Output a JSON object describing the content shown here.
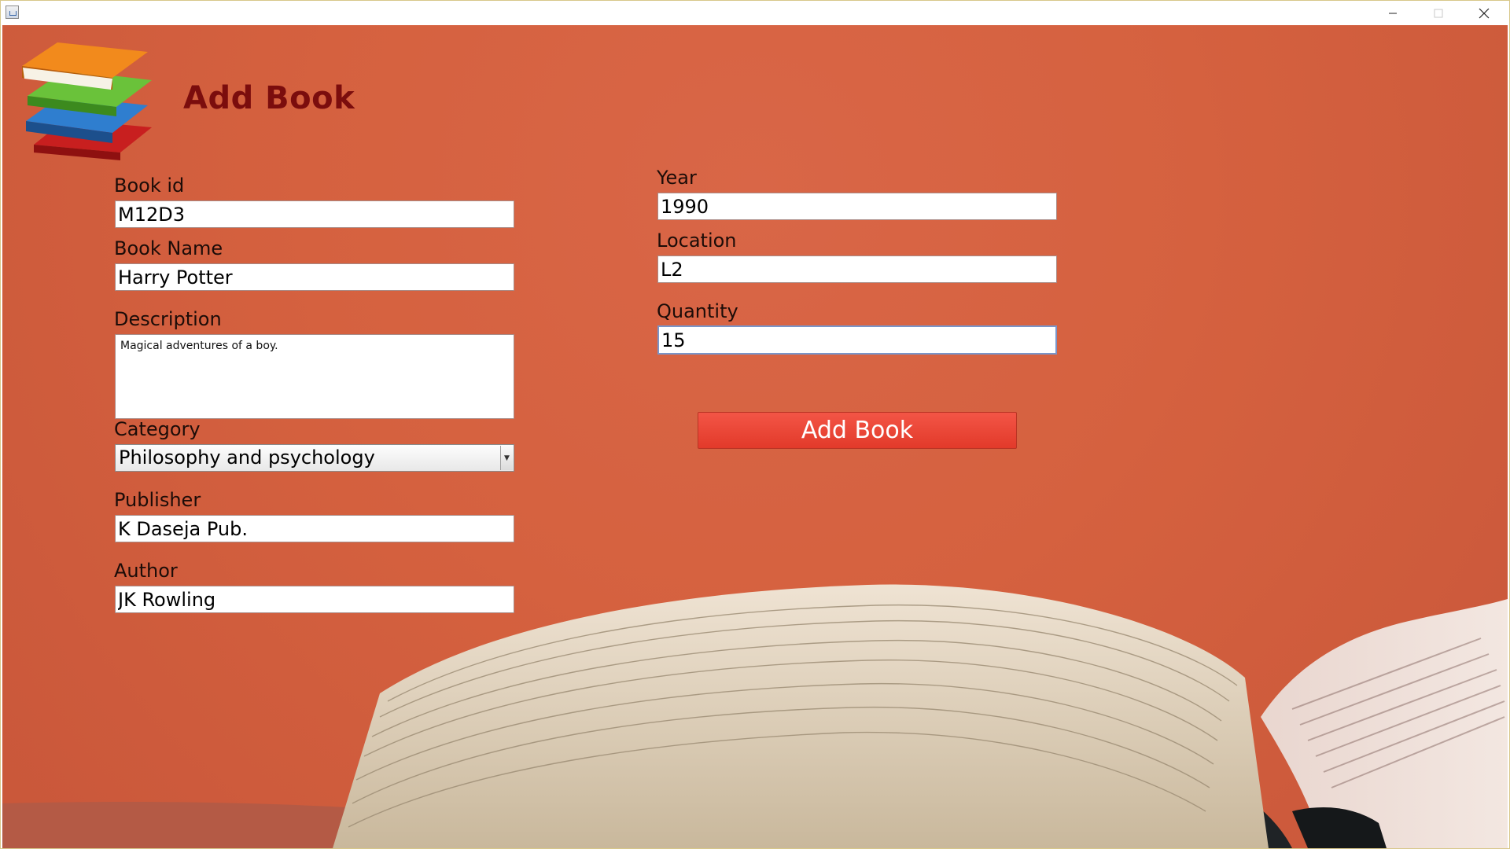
{
  "window": {
    "icon": "java-app-icon",
    "controls": [
      "minimize-icon",
      "maximize-icon",
      "close-icon"
    ]
  },
  "header": {
    "title": "Add Book",
    "logo": "books-stack-icon"
  },
  "form": {
    "book_id": {
      "label": "Book id",
      "value": "M12D3"
    },
    "book_name": {
      "label": "Book Name",
      "value": "Harry Potter"
    },
    "description": {
      "label": "Description",
      "value": "Magical adventures of a boy."
    },
    "category": {
      "label": "Category",
      "value": "Philosophy and psychology"
    },
    "publisher": {
      "label": "Publisher",
      "value": "K Daseja Pub."
    },
    "author": {
      "label": "Author",
      "value": "JK Rowling"
    },
    "year": {
      "label": "Year",
      "value": "1990"
    },
    "location": {
      "label": "Location",
      "value": "L2"
    },
    "quantity": {
      "label": "Quantity",
      "value": "15"
    }
  },
  "actions": {
    "add_book_label": "Add Book"
  },
  "colors": {
    "background": "#d5613f",
    "title": "#7b0d0d",
    "button": "#ee4a3a",
    "button_text": "#ffffff"
  }
}
